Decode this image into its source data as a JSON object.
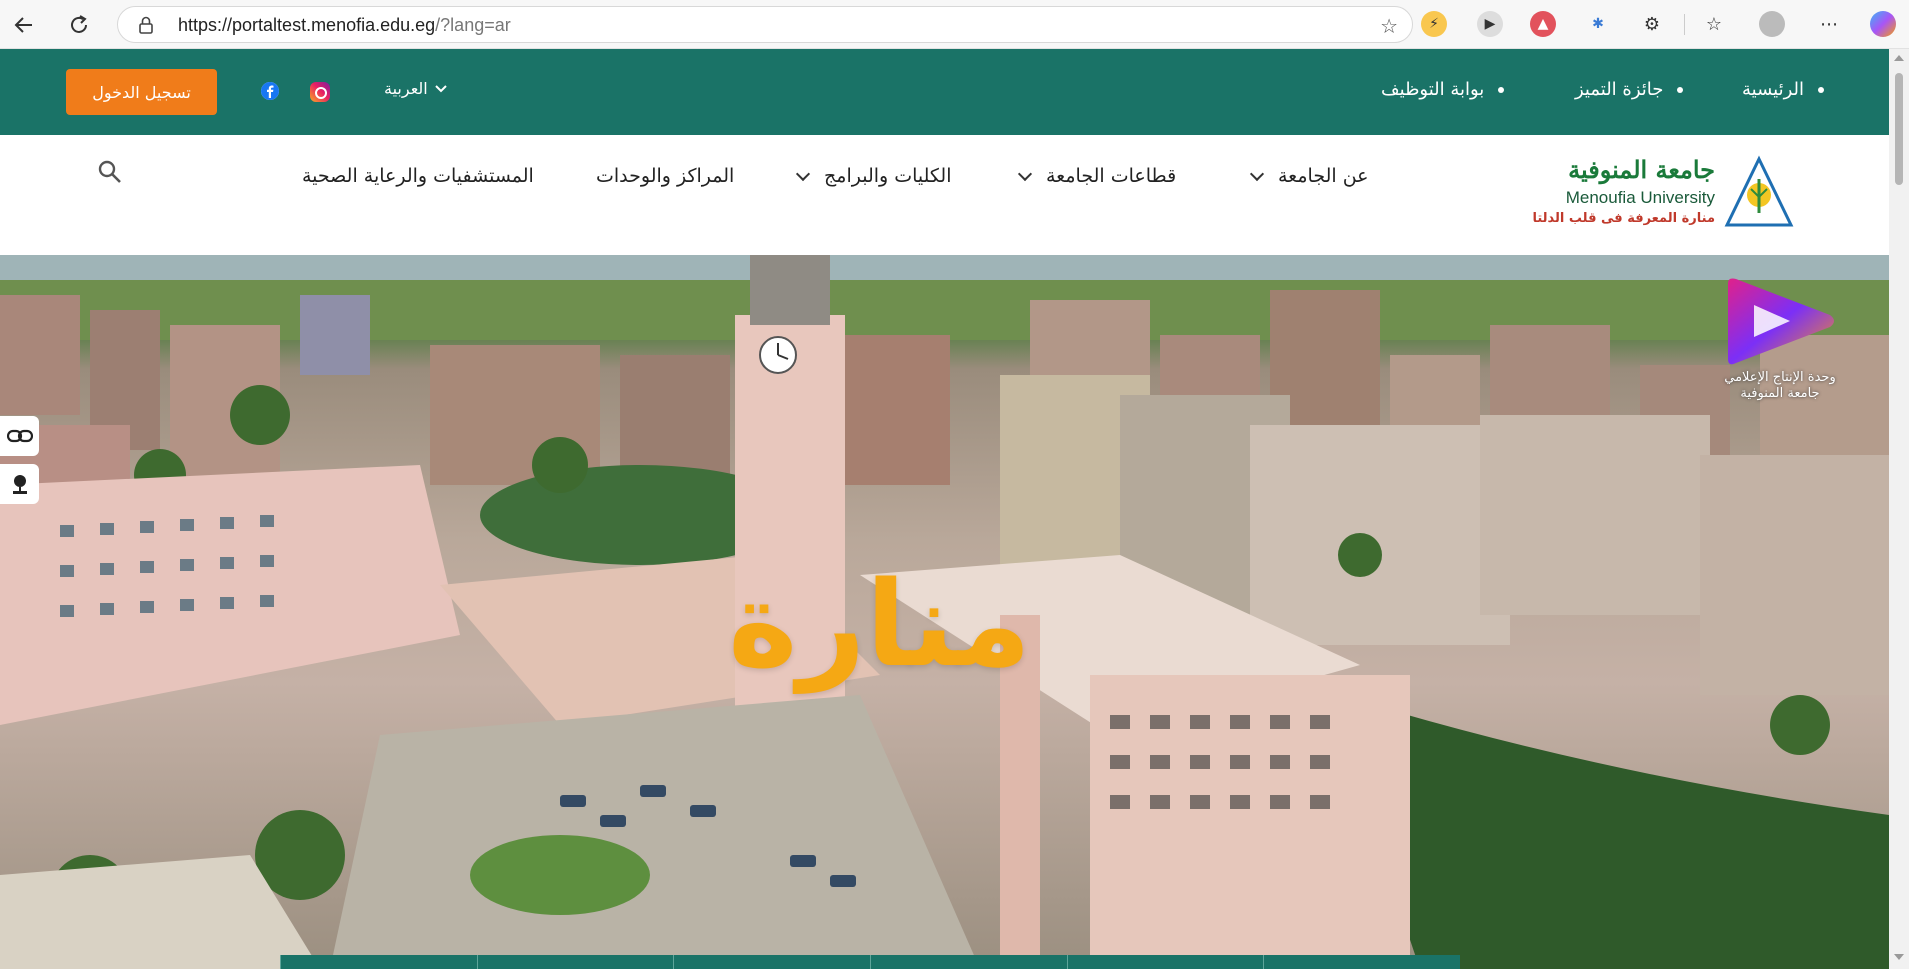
{
  "browser": {
    "url_main": "https://portaltest.menofia.edu.eg",
    "url_rest": "/?lang=ar",
    "icons": [
      "back-icon",
      "reload-icon",
      "lock-icon",
      "favorite-star-icon",
      "extensions-icon",
      "favorites-icon",
      "profile-icon",
      "more-icon",
      "copilot-icon"
    ]
  },
  "topbar": {
    "login_label": "تسجيل الدخول",
    "language_label": "العربية",
    "links": [
      "الرئيسية",
      "جائزة التميز",
      "بوابة التوظيف"
    ],
    "color": "#1a7367",
    "login_color": "#f07c1a"
  },
  "mainnav": {
    "items": [
      {
        "label": "عن الجامعة",
        "dropdown": true
      },
      {
        "label": "قطاعات الجامعة",
        "dropdown": true
      },
      {
        "label": "الكليات والبرامج",
        "dropdown": true
      },
      {
        "label": "المراكز والوحدات",
        "dropdown": false
      },
      {
        "label": "المستشفيات والرعاية الصحية",
        "dropdown": false
      }
    ]
  },
  "logo": {
    "ar_name": "جامعة المنوفية",
    "en_name": "Menoufia University",
    "tagline": "منارة المعرفة فى قلب الدلتا"
  },
  "hero": {
    "title": "منارة",
    "media_unit_line1": "وحدة الإنتاج الإعلامي",
    "media_unit_line2": "جامعة المنوفية",
    "title_color": "#f5a814"
  }
}
